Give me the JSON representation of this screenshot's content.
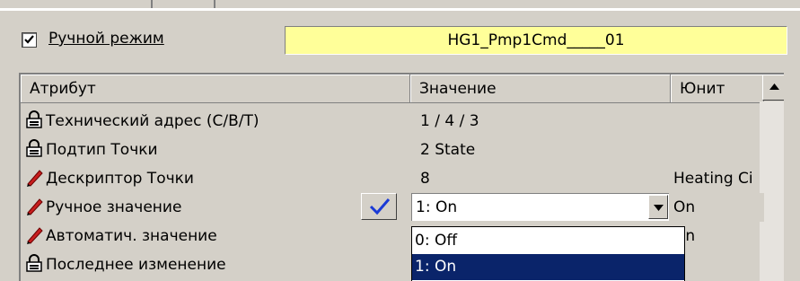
{
  "manual_mode": {
    "checked": true,
    "label": "Ручной режим"
  },
  "point_name": "HG1_Pmp1Cmd_____01",
  "table": {
    "headers": {
      "attribute": "Атрибут",
      "value": "Значение",
      "unit": "Юнит"
    },
    "rows": [
      {
        "icon": "lock-icon",
        "attribute": "Технический адрес (С/В/Т)",
        "value": "1 / 4 / 3",
        "unit": ""
      },
      {
        "icon": "lock-icon",
        "attribute": "Подтип Точки",
        "value": "2 State",
        "unit": ""
      },
      {
        "icon": "pencil-icon",
        "attribute": "Дескриптор Точки",
        "value": "8",
        "unit": "Heating Ci"
      },
      {
        "icon": "pencil-icon",
        "attribute": "Ручное значение",
        "value": "1: On",
        "unit": "On"
      },
      {
        "icon": "pencil-icon",
        "attribute": "Автоматич. значение",
        "value": "",
        "unit": "On"
      },
      {
        "icon": "lock-icon",
        "attribute": "Последнее изменение",
        "value": "",
        "unit": ""
      }
    ]
  },
  "dropdown": {
    "options": [
      "0: Off",
      "1: On"
    ],
    "highlighted": "1: On"
  },
  "colors": {
    "point_name_bg": "#ffff99",
    "selection": "#0a246a",
    "confirm_check": "#1a3ad6"
  }
}
